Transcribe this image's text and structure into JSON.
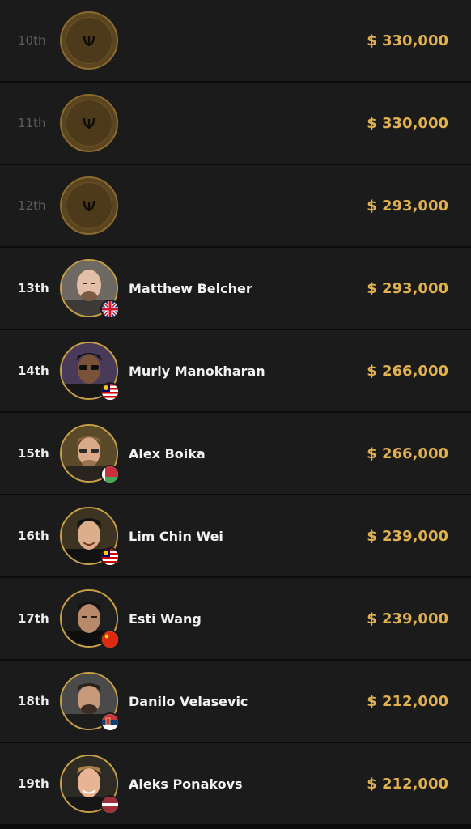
{
  "results": [
    {
      "place": "10th",
      "name": "",
      "prize": "$ 330,000",
      "known": false,
      "flag": ""
    },
    {
      "place": "11th",
      "name": "",
      "prize": "$ 330,000",
      "known": false,
      "flag": ""
    },
    {
      "place": "12th",
      "name": "",
      "prize": "$ 293,000",
      "known": false,
      "flag": ""
    },
    {
      "place": "13th",
      "name": "Matthew Belcher",
      "prize": "$ 293,000",
      "known": true,
      "flag": "uk-flag-icon"
    },
    {
      "place": "14th",
      "name": "Murly Manokharan",
      "prize": "$ 266,000",
      "known": true,
      "flag": "malaysia-flag-icon"
    },
    {
      "place": "15th",
      "name": "Alex Boika",
      "prize": "$ 266,000",
      "known": true,
      "flag": "belarus-flag-icon"
    },
    {
      "place": "16th",
      "name": "Lim Chin Wei",
      "prize": "$ 239,000",
      "known": true,
      "flag": "malaysia-flag-icon"
    },
    {
      "place": "17th",
      "name": "Esti Wang",
      "prize": "$ 239,000",
      "known": true,
      "flag": "china-flag-icon"
    },
    {
      "place": "18th",
      "name": "Danilo Velasevic",
      "prize": "$ 212,000",
      "known": true,
      "flag": "serbia-flag-icon"
    },
    {
      "place": "19th",
      "name": "Aleks Ponakovs",
      "prize": "$ 212,000",
      "known": true,
      "flag": "latvia-flag-icon"
    }
  ],
  "colors": {
    "prize": "#e2b14f",
    "avatar_border": "#c79f45",
    "row_bg": "#1b1b1b"
  }
}
